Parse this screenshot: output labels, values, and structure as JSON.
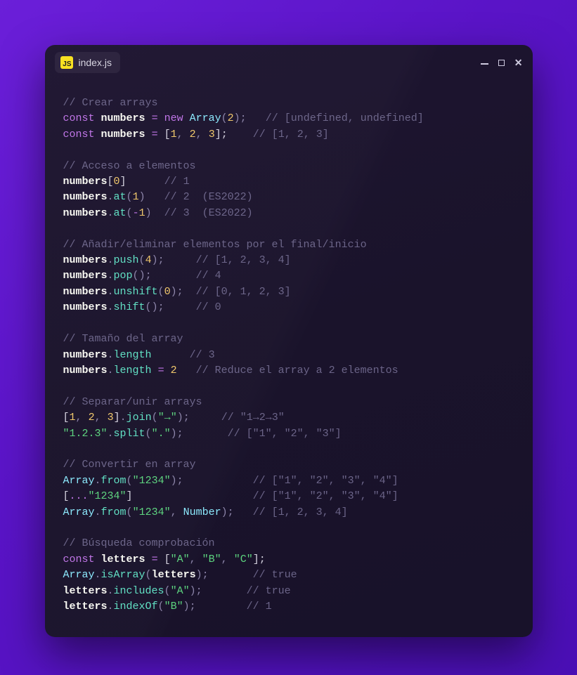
{
  "tab": {
    "badge": "JS",
    "title": "index.js"
  },
  "code": {
    "c1": "// Crear arrays",
    "l2": {
      "const": "const",
      "v": "numbers",
      "eq": "=",
      "new": "new",
      "cls": "Array",
      "po": "(",
      "n": "2",
      "pc": ");",
      "cm": "// [undefined, undefined]"
    },
    "l3": {
      "const": "const",
      "v": "numbers",
      "eq": "=",
      "bo": "[",
      "n1": "1",
      "cma1": ",",
      "n2": "2",
      "cma2": ",",
      "n3": "3",
      "bc": "];",
      "cm": "// [1, 2, 3]"
    },
    "c2": "// Acceso a elementos",
    "l5": {
      "v": "numbers",
      "bo": "[",
      "n": "0",
      "bc": "]",
      "cm": "// 1"
    },
    "l6": {
      "v": "numbers",
      "d": ".",
      "m": "at",
      "po": "(",
      "n": "1",
      "pc": ")",
      "cm": "// 2  (ES2022)"
    },
    "l7": {
      "v": "numbers",
      "d": ".",
      "m": "at",
      "po": "(",
      "mi": "-",
      "n": "1",
      "pc": ")",
      "cm": "// 3  (ES2022)"
    },
    "c3": "// Añadir/eliminar elementos por el final/inicio",
    "l9": {
      "v": "numbers",
      "d": ".",
      "m": "push",
      "po": "(",
      "n": "4",
      "pc": ");",
      "cm": "// [1, 2, 3, 4]"
    },
    "l10": {
      "v": "numbers",
      "d": ".",
      "m": "pop",
      "po": "(",
      "pc": ");",
      "cm": "// 4"
    },
    "l11": {
      "v": "numbers",
      "d": ".",
      "m": "unshift",
      "po": "(",
      "n": "0",
      "pc": ");",
      "cm": "// [0, 1, 2, 3]"
    },
    "l12": {
      "v": "numbers",
      "d": ".",
      "m": "shift",
      "po": "(",
      "pc": ");",
      "cm": "// 0"
    },
    "c4": "// Tamaño del array",
    "l14": {
      "v": "numbers",
      "d": ".",
      "p": "length",
      "cm": "// 3"
    },
    "l15": {
      "v": "numbers",
      "d": ".",
      "p": "length",
      "eq": "=",
      "n": "2",
      "cm": "// Reduce el array a 2 elementos"
    },
    "c5": "// Separar/unir arrays",
    "l17": {
      "bo": "[",
      "n1": "1",
      "c1": ",",
      "n2": "2",
      "c2": ",",
      "n3": "3",
      "bc": "]",
      "d": ".",
      "m": "join",
      "po": "(",
      "s": "\"→\"",
      "pc": ");",
      "cm": "// \"1→2→3\""
    },
    "l18": {
      "s1": "\"1.2.3\"",
      "d": ".",
      "m": "split",
      "po": "(",
      "s2": "\".\"",
      "pc": ");",
      "cm": "// [\"1\", \"2\", \"3\"]"
    },
    "c6": "// Convertir en array",
    "l20": {
      "cls": "Array",
      "d": ".",
      "m": "from",
      "po": "(",
      "s": "\"1234\"",
      "pc": ");",
      "cm": "// [\"1\", \"2\", \"3\", \"4\"]"
    },
    "l21": {
      "bo": "[",
      "sp": "...",
      "s": "\"1234\"",
      "bc": "]",
      "cm": "// [\"1\", \"2\", \"3\", \"4\"]"
    },
    "l22": {
      "cls": "Array",
      "d": ".",
      "m": "from",
      "po": "(",
      "s": "\"1234\"",
      "cma": ",",
      "cls2": "Number",
      "pc": ");",
      "cm": "// [1, 2, 3, 4]"
    },
    "c7": "// Búsqueda comprobación",
    "l24": {
      "const": "const",
      "v": "letters",
      "eq": "=",
      "bo": "[",
      "s1": "\"A\"",
      "c1": ",",
      "s2": "\"B\"",
      "c2": ",",
      "s3": "\"C\"",
      "bc": "];"
    },
    "l25": {
      "cls": "Array",
      "d": ".",
      "m": "isArray",
      "po": "(",
      "v": "letters",
      "pc": ");",
      "cm": "// true"
    },
    "l26": {
      "v": "letters",
      "d": ".",
      "m": "includes",
      "po": "(",
      "s": "\"A\"",
      "pc": ");",
      "cm": "// true"
    },
    "l27": {
      "v": "letters",
      "d": ".",
      "m": "indexOf",
      "po": "(",
      "s": "\"B\"",
      "pc": ");",
      "cm": "// 1"
    }
  }
}
